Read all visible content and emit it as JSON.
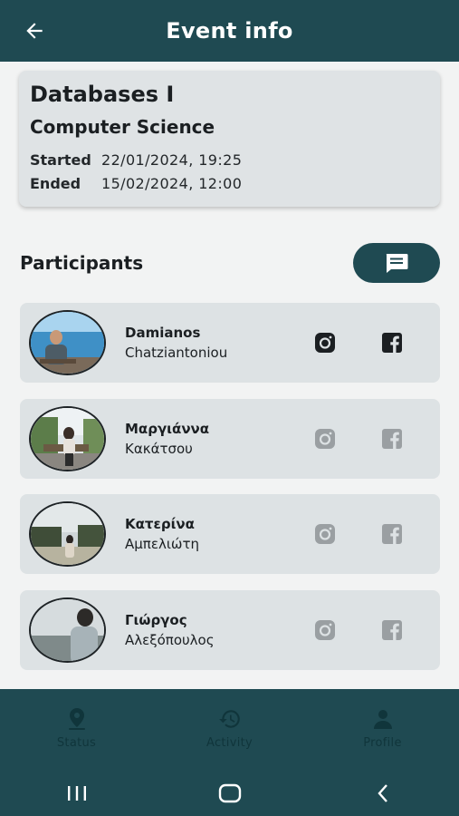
{
  "appbar": {
    "title": "Event info",
    "back_icon": "arrow-left-icon"
  },
  "event": {
    "title": "Databases I",
    "subtitle": "Computer Science",
    "started_label": "Started",
    "started_value": "22/01/2024, 19:25",
    "ended_label": "Ended",
    "ended_value": "15/02/2024, 12:00"
  },
  "participants": {
    "title": "Participants",
    "chat_icon": "message-icon",
    "items": [
      {
        "first": "Damianos",
        "last": "Chatziantoniou",
        "instagram_active": true,
        "facebook_active": true
      },
      {
        "first": "Μαργιάννα",
        "last": "Κακάτσου",
        "instagram_active": false,
        "facebook_active": false
      },
      {
        "first": "Κατερίνα",
        "last": "Αμπελιώτη",
        "instagram_active": false,
        "facebook_active": false
      },
      {
        "first": "Γιώργος",
        "last": "Αλεξόπουλος",
        "instagram_active": false,
        "facebook_active": false
      }
    ]
  },
  "bottom_nav": {
    "items": [
      {
        "label": "Status",
        "icon": "location-pin-icon"
      },
      {
        "label": "Activity",
        "icon": "history-icon"
      },
      {
        "label": "Profile",
        "icon": "person-icon"
      }
    ]
  },
  "colors": {
    "primary": "#1f4a52",
    "card": "#dde2e4",
    "icon_active": "#1b1f22",
    "icon_inactive": "#9a9fa2"
  }
}
